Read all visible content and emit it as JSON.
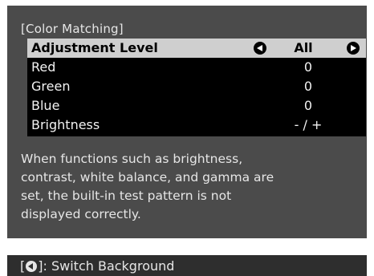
{
  "menu": {
    "title": "[Color Matching]",
    "rows": [
      {
        "label": "Adjustment Level",
        "value": "All",
        "selected": true
      },
      {
        "label": "Red",
        "value": "0"
      },
      {
        "label": "Green",
        "value": "0"
      },
      {
        "label": "Blue",
        "value": "0"
      },
      {
        "label": "Brightness",
        "value": "- / +"
      }
    ],
    "arrow_icons": [
      "left-arrow-icon",
      "right-arrow-icon"
    ]
  },
  "description": {
    "lines": [
      "When functions such as brightness,",
      "contrast, white balance, and gamma are",
      "set, the built-in test pattern is not",
      "displayed correctly."
    ]
  },
  "footer": {
    "bracket_open": "[",
    "bracket_close": "]",
    "action": ": Switch Background",
    "icon": "enter-icon"
  },
  "colors": {
    "panel": "#4b4b4b",
    "menu_bg": "#000000",
    "selected_row": "#cfcfcf",
    "footer_bg": "#2e2e2e",
    "text": "#e6e6e6"
  }
}
